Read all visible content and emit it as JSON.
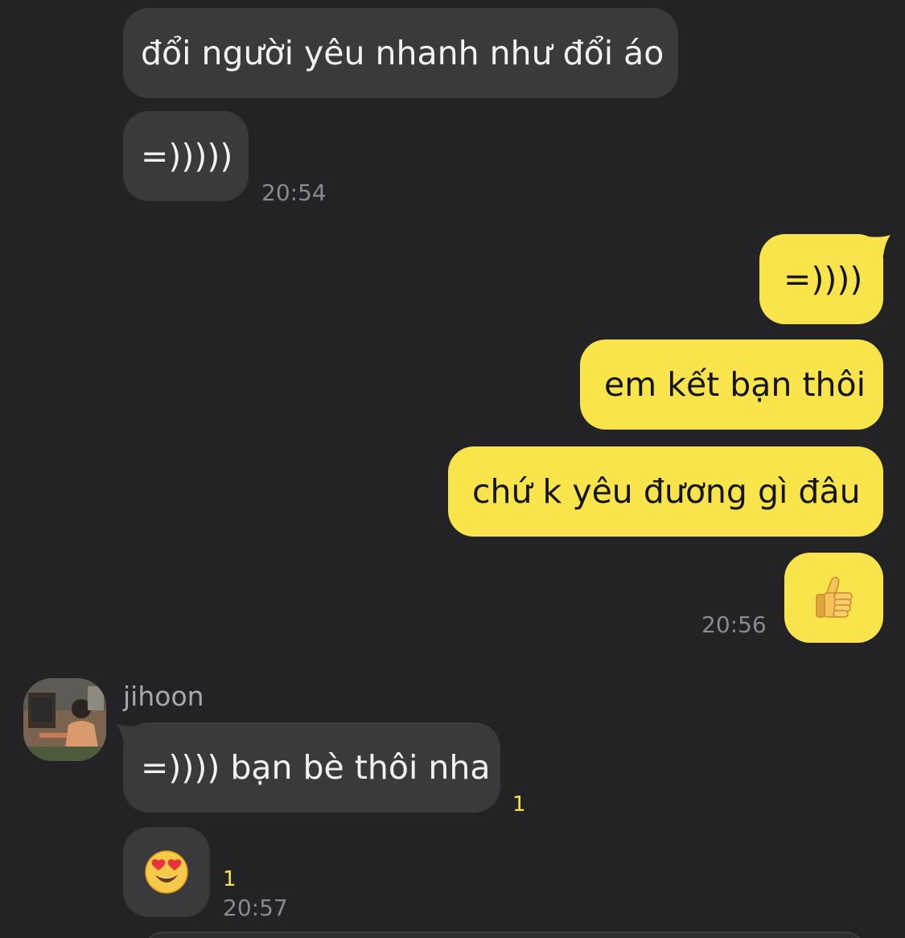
{
  "messages": {
    "m1": {
      "text": "đổi người yêu nhanh như đổi áo"
    },
    "m2": {
      "text": "=)))))",
      "time": "20:54"
    },
    "m3": {
      "text": "=))))"
    },
    "m4": {
      "text": "em kết bạn thôi"
    },
    "m5": {
      "text": "chứ k yêu đương gì đâu"
    },
    "m6": {
      "emoji": "thumbs-up",
      "time": "20:56"
    },
    "m7": {
      "sender": "jihoon",
      "text": "=)))) bạn bè thôi nha",
      "unread": "1"
    },
    "m8": {
      "emoji": "heart-eyes",
      "unread": "1",
      "time": "20:57"
    }
  },
  "colors": {
    "background": "#232325",
    "incoming_bubble": "#3a3a3c",
    "outgoing_bubble": "#f9e44b",
    "unread_count": "#f9e44b",
    "timestamp": "#8a8a8e"
  }
}
